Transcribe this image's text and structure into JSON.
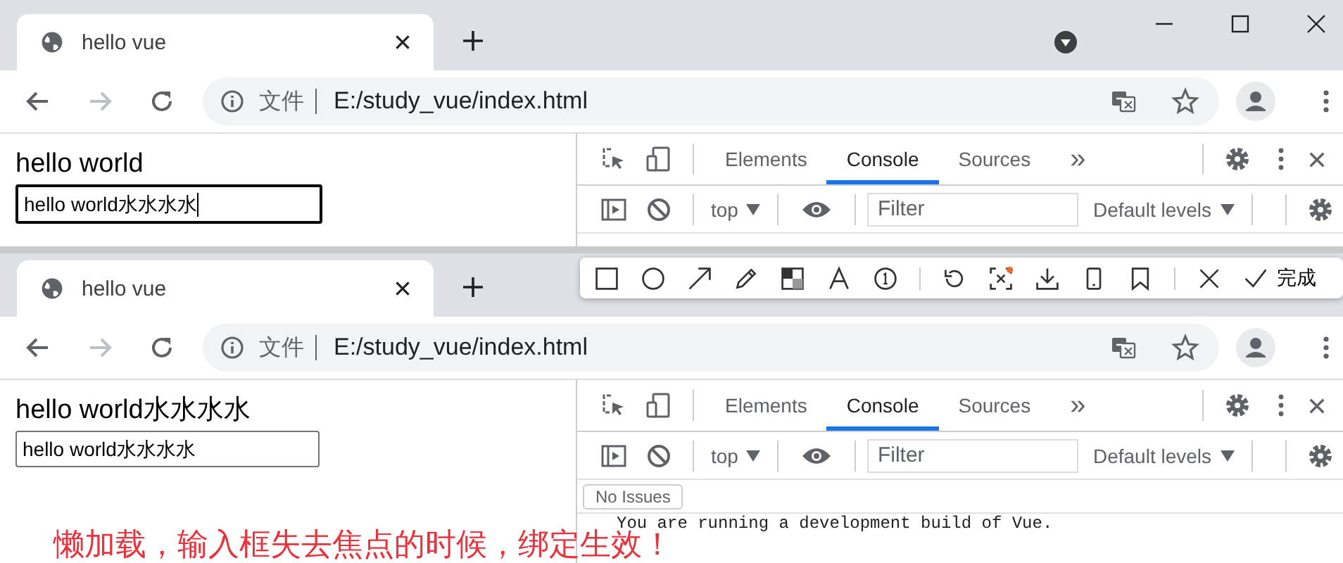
{
  "windows": [
    {
      "tab": {
        "title": "hello vue"
      },
      "window_controls": true,
      "address": {
        "scheme": "文件",
        "url": "E:/study_vue/index.html"
      },
      "page": {
        "heading": "hello world",
        "input": {
          "value": "hello world水水水水",
          "focused": true
        }
      },
      "devtools": {
        "tabs": [
          {
            "label": "Elements",
            "selected": false
          },
          {
            "label": "Console",
            "selected": true
          },
          {
            "label": "Sources",
            "selected": false
          }
        ],
        "more": "»",
        "context": "top",
        "filter_placeholder": "Filter",
        "levels": "Default levels"
      }
    },
    {
      "tab": {
        "title": "hello vue"
      },
      "window_controls": false,
      "address": {
        "scheme": "文件",
        "url": "E:/study_vue/index.html"
      },
      "page": {
        "heading": "hello world水水水水",
        "input": {
          "value": "hello world水水水水",
          "focused": false
        }
      },
      "devtools": {
        "tabs": [
          {
            "label": "Elements",
            "selected": false
          },
          {
            "label": "Console",
            "selected": true
          },
          {
            "label": "Sources",
            "selected": false
          }
        ],
        "more": "»",
        "context": "top",
        "filter_placeholder": "Filter",
        "levels": "Default levels",
        "issues": "No Issues",
        "console_lines": [
          "You are running a development build of Vue."
        ]
      }
    }
  ],
  "annotation_toolbar": {
    "done": "完成"
  },
  "caption": "懒加载，输入框失去焦点的时候，绑定生效！"
}
